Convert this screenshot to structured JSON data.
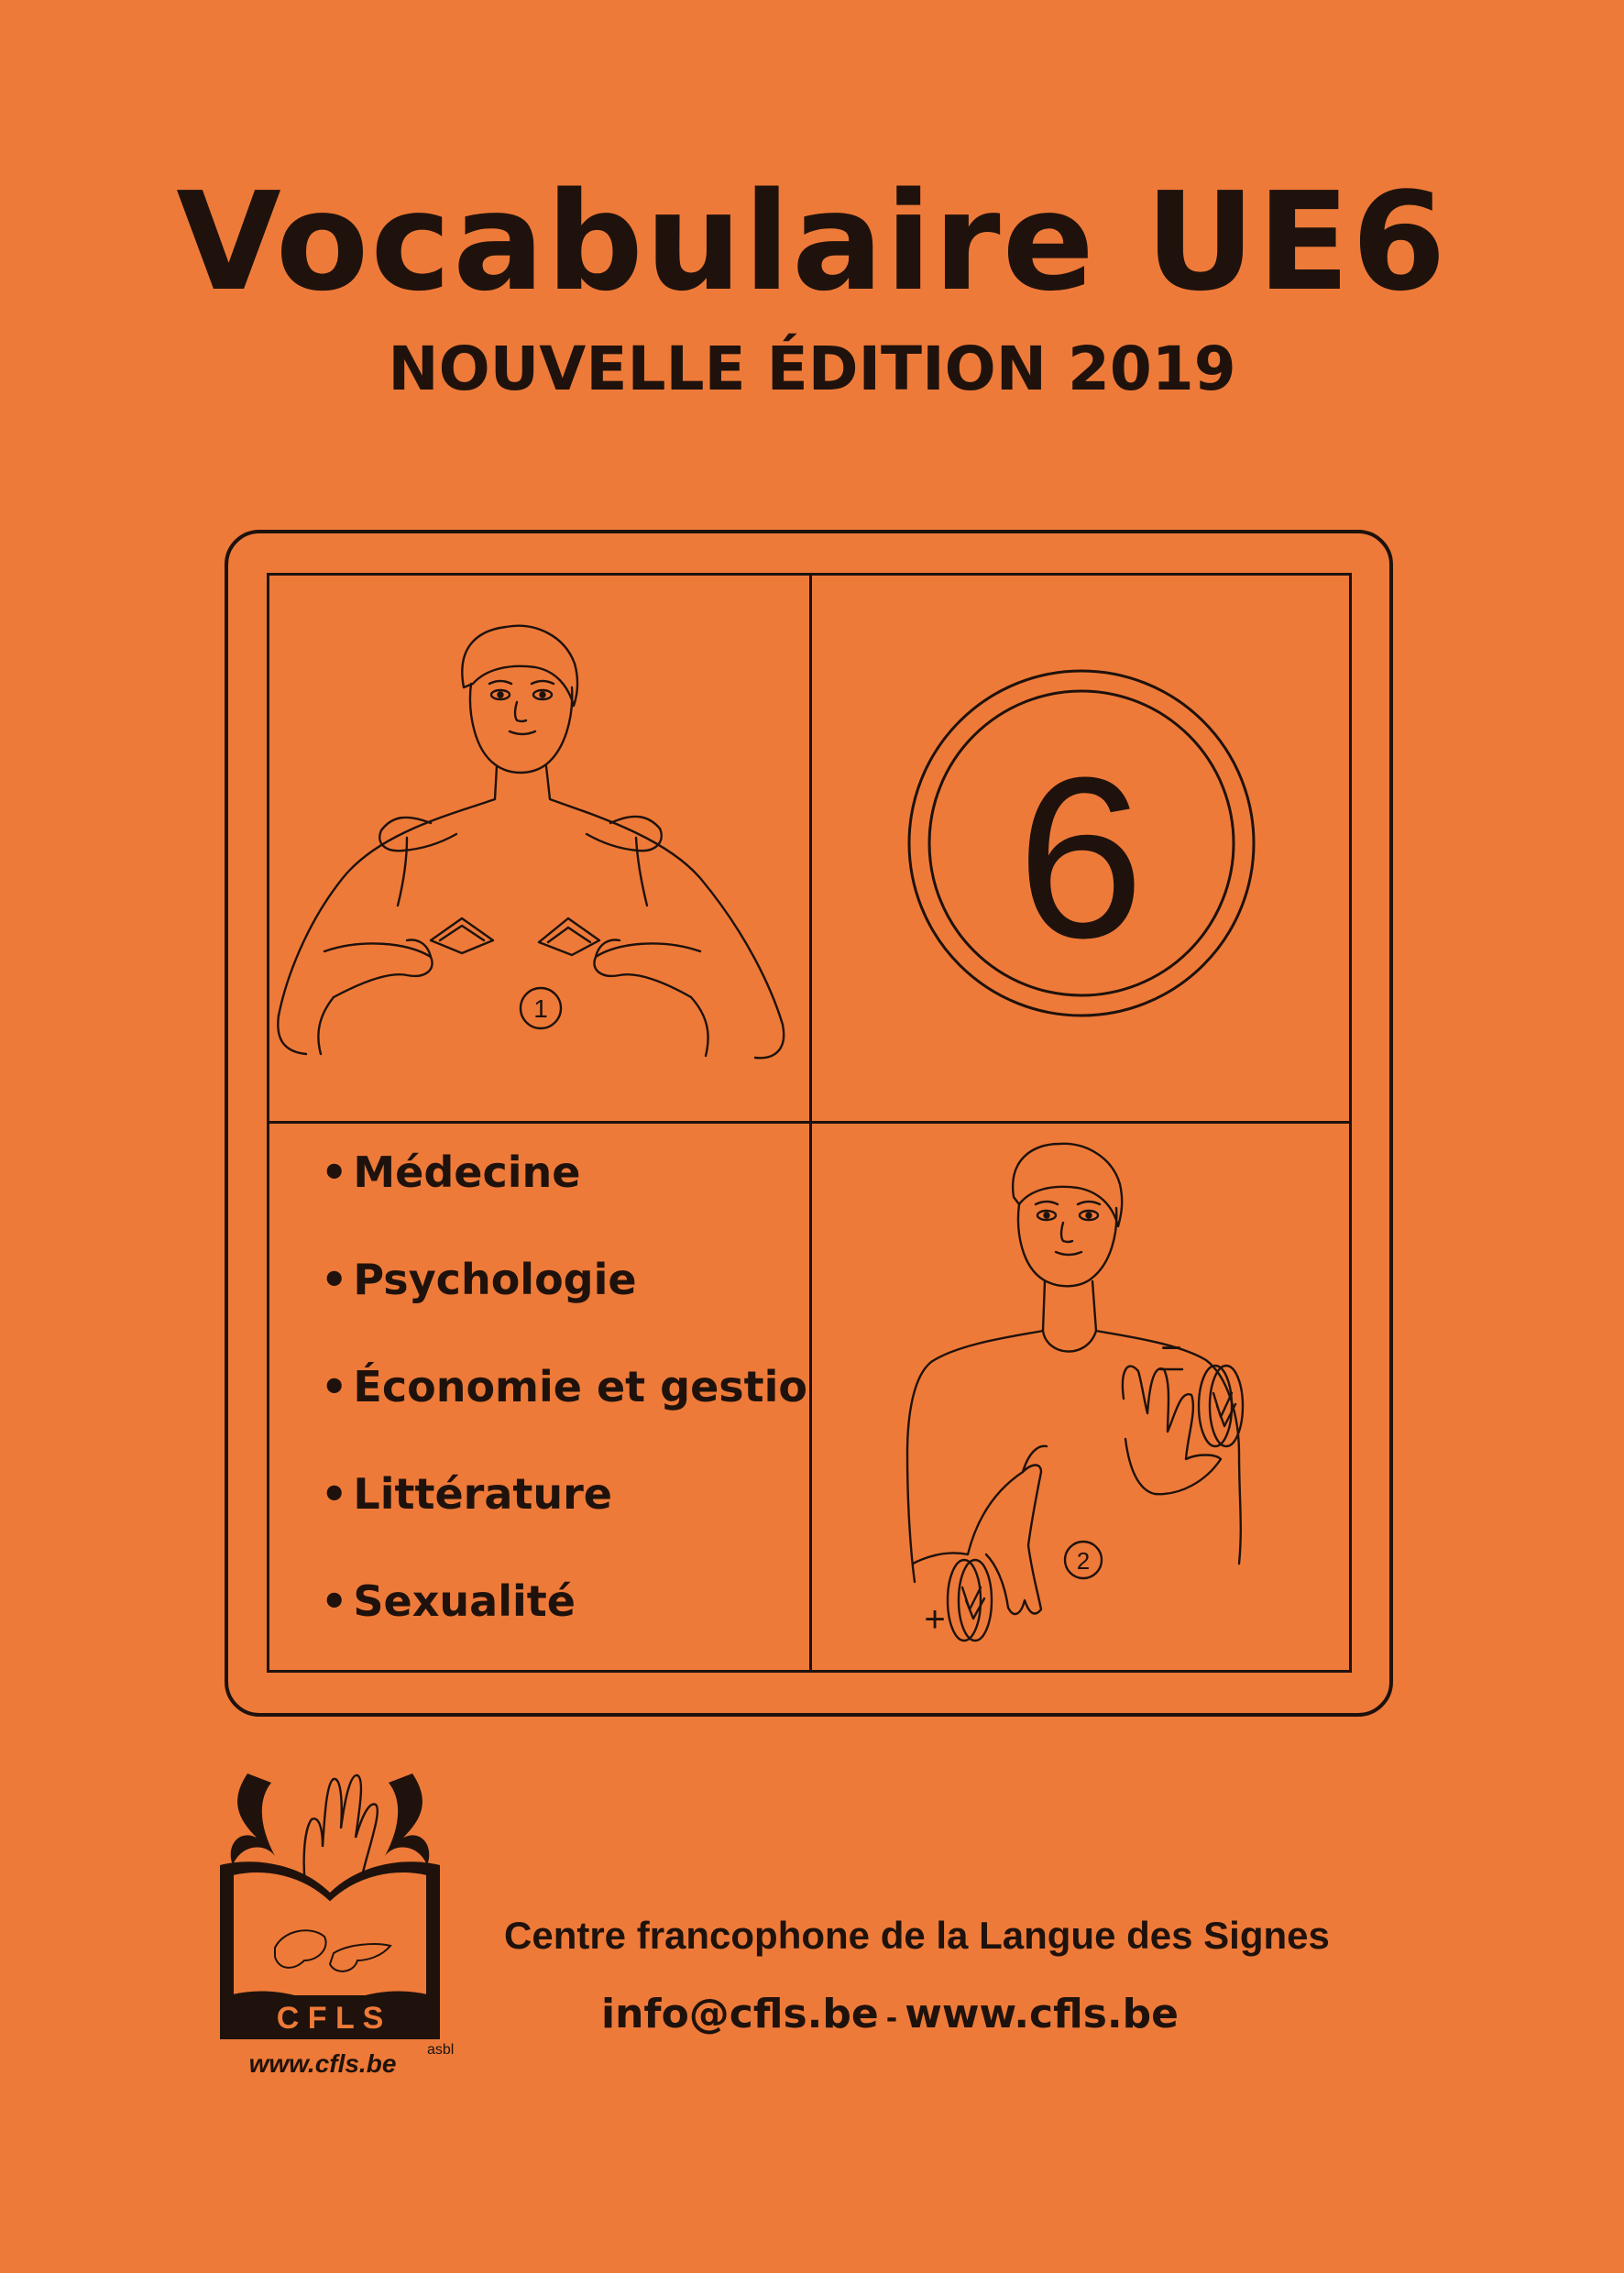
{
  "title": "Vocabulaire UE6",
  "subtitle": "NOUVELLE ÉDITION 2019",
  "panel": {
    "number": "6",
    "sign1_step": "1",
    "sign2_step": "2",
    "sign2_minus": "−",
    "sign2_plus": "+",
    "topics": [
      {
        "bullet": "•",
        "label": "Médecine"
      },
      {
        "bullet": "•",
        "label": "Psychologie"
      },
      {
        "bullet": "•",
        "label": "Économie et gestion"
      },
      {
        "bullet": "•",
        "label": "Littérature"
      },
      {
        "bullet": "•",
        "label": "Sexualité"
      }
    ]
  },
  "footer": {
    "logo_text": "C F L S",
    "logo_url": "www.cfls.be",
    "asbl": "asbl",
    "org_name": "Centre francophone de la Langue des Signes",
    "email": "info@cfls.be",
    "separator": "-",
    "website": "www.cfls.be"
  },
  "colors": {
    "background": "#ee7a39",
    "ink": "#1f120c"
  }
}
